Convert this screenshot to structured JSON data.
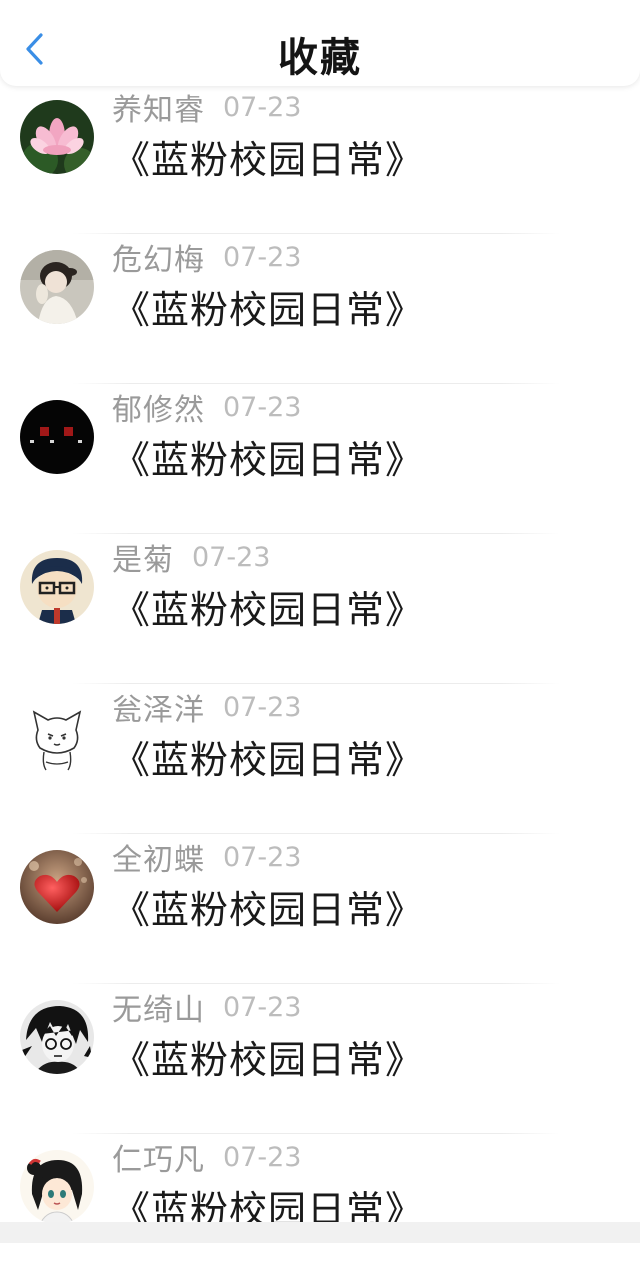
{
  "header": {
    "title": "收藏",
    "back_icon": "chevron-left-icon",
    "accent_color": "#3a8ee6"
  },
  "favorites": [
    {
      "author": "养知睿",
      "date": "07-23",
      "title": "《蓝粉校园日常》",
      "avatar": "lotus-avatar"
    },
    {
      "author": "危幻梅",
      "date": "07-23",
      "title": "《蓝粉校园日常》",
      "avatar": "girl-photo-avatar"
    },
    {
      "author": "郁修然",
      "date": "07-23",
      "title": "《蓝粉校园日常》",
      "avatar": "black-text-avatar"
    },
    {
      "author": "是菊",
      "date": "07-23",
      "title": "《蓝粉校园日常》",
      "avatar": "glasses-boy-avatar"
    },
    {
      "author": "瓮泽洋",
      "date": "07-23",
      "title": "《蓝粉校园日常》",
      "avatar": "cat-sketch-avatar"
    },
    {
      "author": "全初蝶",
      "date": "07-23",
      "title": "《蓝粉校园日常》",
      "avatar": "red-heart-avatar"
    },
    {
      "author": "无绮山",
      "date": "07-23",
      "title": "《蓝粉校园日常》",
      "avatar": "anime-boy-avatar"
    },
    {
      "author": "仁巧凡",
      "date": "07-23",
      "title": "《蓝粉校园日常》",
      "avatar": "anime-girl-avatar"
    }
  ]
}
